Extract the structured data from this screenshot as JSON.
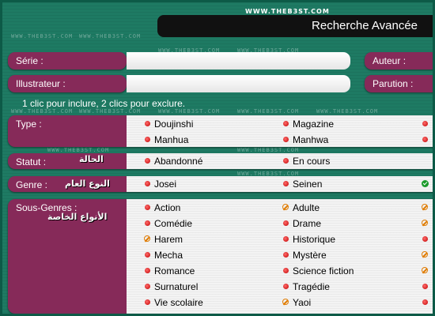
{
  "watermark": "WWW.THEB3ST.COM",
  "title": "Recherche Avancée",
  "fields": {
    "serie": "Série :",
    "auteur": "Auteur :",
    "illustrateur": "Illustrateur :",
    "parution": "Parution :"
  },
  "hint": "1 clic pour inclure, 2 clics pour exclure.",
  "sections": {
    "type": {
      "label": "Type :"
    },
    "statut": {
      "label": "Statut :",
      "arabic": "الحالة"
    },
    "genre": {
      "label": "Genre :",
      "arabic": "النوع العام"
    },
    "sous_genres": {
      "label": "Sous-Genres :",
      "arabic": "الأنواع الخاصة"
    }
  },
  "options": {
    "type": [
      {
        "label": "Doujinshi",
        "icon": "red"
      },
      {
        "label": "Magazine",
        "icon": "red"
      },
      {
        "label": "Manhua",
        "icon": "red"
      },
      {
        "label": "Manhwa",
        "icon": "red"
      }
    ],
    "statut": [
      {
        "label": "Abandonné",
        "icon": "red"
      },
      {
        "label": "En cours",
        "icon": "red"
      }
    ],
    "genre": [
      {
        "label": "Josei",
        "icon": "red"
      },
      {
        "label": "Seinen",
        "icon": "red"
      },
      {
        "label": "",
        "icon": "ok"
      }
    ],
    "sous_genres": [
      {
        "label": "Action",
        "icon": "red"
      },
      {
        "label": "Adulte",
        "icon": "ban"
      },
      {
        "label": "Comédie",
        "icon": "red"
      },
      {
        "label": "Drame",
        "icon": "red"
      },
      {
        "label": "Harem",
        "icon": "ban"
      },
      {
        "label": "Historique",
        "icon": "red"
      },
      {
        "label": "Mecha",
        "icon": "red"
      },
      {
        "label": "Mystère",
        "icon": "red"
      },
      {
        "label": "Romance",
        "icon": "red"
      },
      {
        "label": "Science fiction",
        "icon": "red"
      },
      {
        "label": "Surnaturel",
        "icon": "red"
      },
      {
        "label": "Tragédie",
        "icon": "red"
      },
      {
        "label": "Vie scolaire",
        "icon": "red"
      },
      {
        "label": "Yaoi",
        "icon": "ban"
      }
    ]
  }
}
